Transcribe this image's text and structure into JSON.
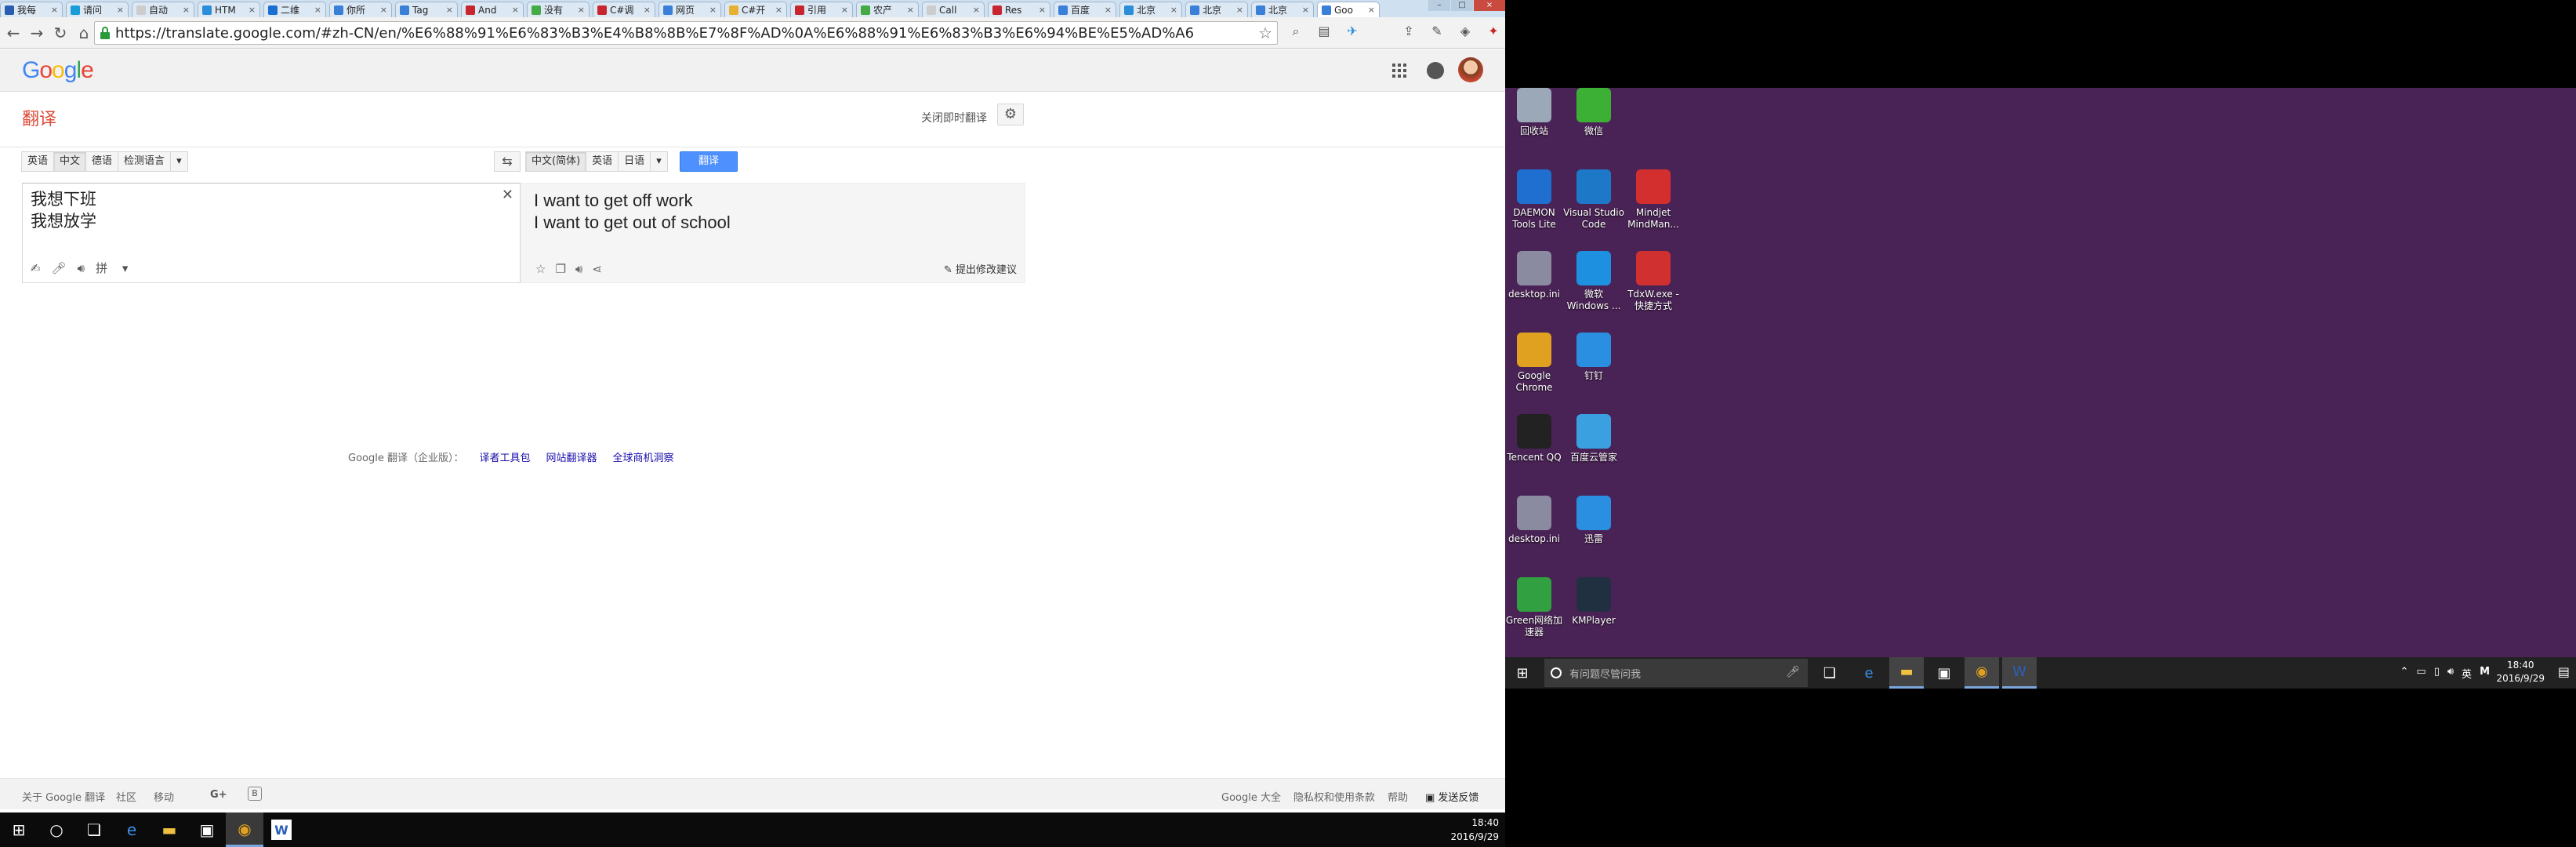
{
  "browser": {
    "tabs": [
      {
        "title": "我每",
        "color": "#2a5db0"
      },
      {
        "title": "请问",
        "color": "#1a9cd8"
      },
      {
        "title": "自动",
        "color": "#cccccc"
      },
      {
        "title": "HTM",
        "color": "#2a8fd8"
      },
      {
        "title": "二维",
        "color": "#1a6fd0"
      },
      {
        "title": "你所",
        "color": "#3a7fd8"
      },
      {
        "title": "Tag",
        "color": "#3a7fd8"
      },
      {
        "title": "And",
        "color": "#c8262f"
      },
      {
        "title": "没有",
        "color": "#44aa44"
      },
      {
        "title": "C#调",
        "color": "#c8262f"
      },
      {
        "title": "网页",
        "color": "#3a7fd8"
      },
      {
        "title": "C#开",
        "color": "#e8b030"
      },
      {
        "title": "引用",
        "color": "#c8262f"
      },
      {
        "title": "农产",
        "color": "#44aa44"
      },
      {
        "title": "Call",
        "color": "#cccccc"
      },
      {
        "title": "Res",
        "color": "#c8262f"
      },
      {
        "title": "百度",
        "color": "#3a7fd8"
      },
      {
        "title": "北京",
        "color": "#2a8fd8"
      },
      {
        "title": "北京",
        "color": "#3a7fd8"
      },
      {
        "title": "北京",
        "color": "#3a7fd8"
      },
      {
        "title": "Goo",
        "color": "#3a7fd8",
        "active": true
      }
    ],
    "url": "https://translate.google.com/#zh-CN/en/%E6%88%91%E6%83%B3%E4%B8%8B%E7%8F%AD%0A%E6%88%91%E6%83%B3%E6%94%BE%E5%AD%A6"
  },
  "google": {
    "logo": "Google",
    "logo_colors": [
      "#4285f4",
      "#ea4335",
      "#fbbc05",
      "#4285f4",
      "#34a853",
      "#ea4335"
    ]
  },
  "translate": {
    "title": "翻译",
    "instant_link": "关闭即时翻译",
    "source_langs": [
      "英语",
      "中文",
      "德语",
      "检测语言"
    ],
    "target_langs": [
      "中文(简体)",
      "英语",
      "日语"
    ],
    "translate_button": "翻译",
    "source_text": "我想下班\n我想放学",
    "result_text": "I want to get off work\nI want to get out of school",
    "pinyin_label": "拼",
    "suggest_label": "提出修改建议"
  },
  "footer_links": {
    "prefix": "Google 翻译（企业版）：",
    "links": [
      "译者工具包",
      "网站翻译器",
      "全球商机洞察"
    ]
  },
  "gfooter": {
    "about": "关于 Google 翻译",
    "community": "社区",
    "mobile": "移动",
    "google_all": "Google 大全",
    "privacy": "隐私权和使用条款",
    "help": "帮助",
    "feedback": "发送反馈"
  },
  "taskbar_left": {
    "time": "18:40",
    "date": "2016/9/29"
  },
  "desktop_icons": [
    {
      "label": "回收站",
      "color": "#9aa8b8"
    },
    {
      "label": "微信",
      "color": "#3cb034"
    },
    {
      "label": "DAEMON Tools Lite",
      "color": "#1e6fd0"
    },
    {
      "label": "Visual Studio Code",
      "color": "#1e78c8"
    },
    {
      "label": "Mindjet MindMan...",
      "color": "#d32f2f"
    },
    {
      "label": "desktop.ini",
      "color": "#8a8aa0"
    },
    {
      "label": "微软 Windows ...",
      "color": "#1e90e0"
    },
    {
      "label": "TdxW.exe - 快捷方式",
      "color": "#d03030"
    },
    {
      "label": "Google Chrome",
      "color": "#e0a020"
    },
    {
      "label": "钉钉",
      "color": "#2a8fe0"
    },
    {
      "label": "Tencent QQ",
      "color": "#222222"
    },
    {
      "label": "百度云管家",
      "color": "#3aa0e0"
    },
    {
      "label": "desktop.ini",
      "color": "#8a8aa0"
    },
    {
      "label": "迅雷",
      "color": "#2a8fe0"
    },
    {
      "label": "Green网络加速器",
      "color": "#30a040"
    },
    {
      "label": "KMPlayer",
      "color": "#203040"
    }
  ],
  "taskbar_right": {
    "search_placeholder": "有问题尽管问我",
    "ime": "英",
    "time": "18:40",
    "date": "2016/9/29"
  }
}
